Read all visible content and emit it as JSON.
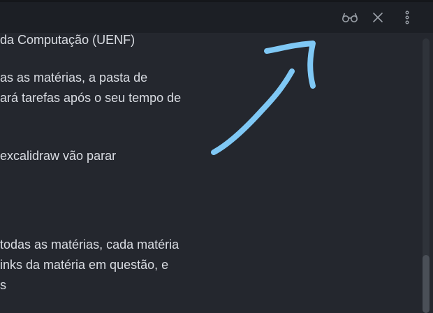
{
  "toolbar": {
    "icons": [
      "reading-glasses-icon",
      "close-icon",
      "more-options-icon"
    ],
    "background": "#1c1f25"
  },
  "content": {
    "lines": [
      "da Computação (UENF)",
      "as as matérias, a pasta de",
      "ará tarefas após o seu tempo de",
      "excalidraw vão parar",
      "todas as matérias, cada matéria",
      "inks da matéria em questão, e",
      "s"
    ],
    "text_color": "#dadde3"
  },
  "annotation": {
    "icon": "hand-drawn-arrow",
    "color": "#7fc8f5"
  }
}
